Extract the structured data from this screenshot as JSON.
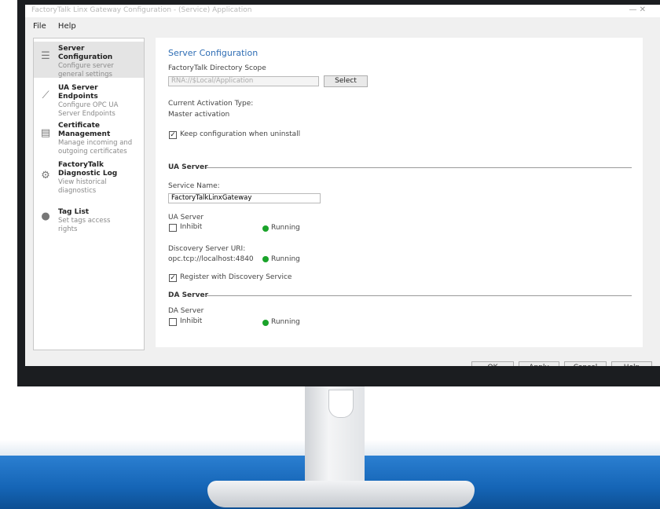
{
  "window": {
    "title": "FactoryTalk Linx Gateway Configuration - (Service) Application",
    "controls": "—   ✕"
  },
  "menu": {
    "file": "File",
    "help": "Help"
  },
  "sidebar": {
    "items": [
      {
        "title": "Server Configuration",
        "desc": "Configure server general settings",
        "icon": "server-icon"
      },
      {
        "title": "UA Server Endpoints",
        "desc": "Configure OPC UA Server Endpoints",
        "icon": "link-icon"
      },
      {
        "title": "Certificate Management",
        "desc": "Manage incoming and outgoing certificates",
        "icon": "certificate-icon"
      },
      {
        "title": "FactoryTalk Diagnostic Log",
        "desc": "View historical diagnostics",
        "icon": "gear-icon"
      },
      {
        "title": "Tag List",
        "desc": "Set tags access rights",
        "icon": "info-icon"
      }
    ]
  },
  "panel": {
    "heading": "Server Configuration",
    "directory_label": "FactoryTalk Directory Scope",
    "directory_value": "RNA://$Local/Application",
    "select_button": "Select",
    "activation_label": "Current Activation Type:",
    "activation_value": "Master activation",
    "keep_config_label": "Keep configuration when uninstall",
    "keep_config_checked": true,
    "ua_section": "UA Server",
    "service_name_label": "Service Name:",
    "service_name_value": "FactoryTalkLinxGateway",
    "ua_server_label": "UA Server",
    "ua_inhibit_label": "Inhibit",
    "ua_status": "Running",
    "discovery_label": "Discovery Server URI:",
    "discovery_value": "opc.tcp://localhost:4840",
    "discovery_status": "Running",
    "register_label": "Register with Discovery Service",
    "register_checked": true,
    "da_section": "DA Server",
    "da_server_label": "DA Server",
    "da_inhibit_label": "Inhibit",
    "da_status": "Running"
  },
  "buttons": {
    "ok": "OK",
    "apply": "Apply",
    "cancel": "Cancel",
    "help": "Help"
  },
  "colors": {
    "accent": "#2e6db4",
    "running": "#1aa32a",
    "desk": "#1565b6"
  }
}
